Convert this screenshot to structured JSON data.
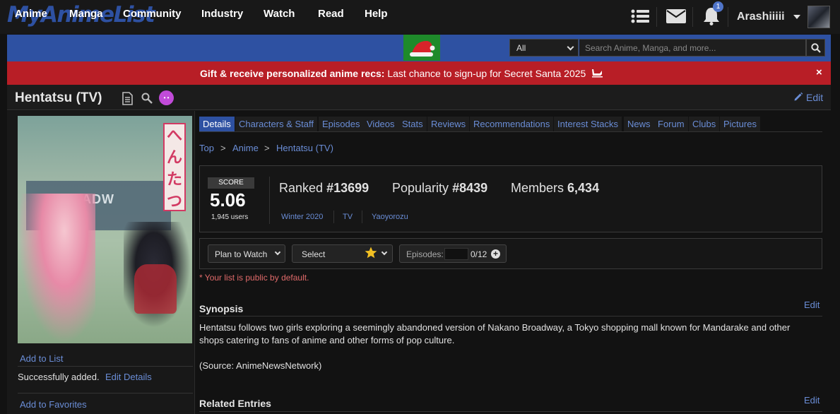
{
  "header": {
    "logo": "MyAnimeList",
    "notification_count": "1",
    "username": "Arashiiiii"
  },
  "nav": {
    "items": [
      "Anime",
      "Manga",
      "Community",
      "Industry",
      "Watch",
      "Read",
      "Help"
    ],
    "search_category": "All",
    "search_placeholder": "Search Anime, Manga, and more..."
  },
  "banner": {
    "bold": "Gift & receive personalized anime recs:",
    "text": " Last chance to sign-up for Secret Santa 2025",
    "close": "×"
  },
  "title": {
    "text": "Hentatsu (TV)",
    "edit": "Edit",
    "badge": "• •"
  },
  "sidebar": {
    "add_to_list": "Add to List",
    "success_text": "Successfully added.",
    "edit_details": "Edit Details",
    "add_to_favorites": "Add to Favorites",
    "cover_text": "BROADW",
    "cover_vertical": "へんたつ"
  },
  "tabs": [
    "Details",
    "Characters & Staff",
    "Episodes",
    "Videos",
    "Stats",
    "Reviews",
    "Recommendations",
    "Interest Stacks",
    "News",
    "Forum",
    "Clubs",
    "Pictures"
  ],
  "breadcrumb": [
    "Top",
    "Anime",
    "Hentatsu (TV)"
  ],
  "stats": {
    "score_label": "SCORE",
    "score": "5.06",
    "score_users": "1,945 users",
    "ranked_label": "Ranked",
    "ranked_value": "#13699",
    "popularity_label": "Popularity",
    "popularity_value": "#8439",
    "members_label": "Members",
    "members_value": "6,434",
    "season": "Winter 2020",
    "type": "TV",
    "studio": "Yaoyorozu"
  },
  "list": {
    "status": "Plan to Watch",
    "score_select": "Select",
    "episodes_label": "Episodes:",
    "episodes_count": "0/12",
    "plus": "+",
    "public_note": "* Your list is public by default."
  },
  "synopsis": {
    "title": "Synopsis",
    "edit": "Edit",
    "text": "Hentatsu follows two girls exploring a seemingly abandoned version of Nakano Broadway, a Tokyo shopping mall known for Mandarake and other shops catering to fans of anime and other forms of pop culture.",
    "source": "(Source: AnimeNewsNetwork)"
  },
  "related": {
    "title": "Related Entries",
    "edit": "Edit"
  }
}
